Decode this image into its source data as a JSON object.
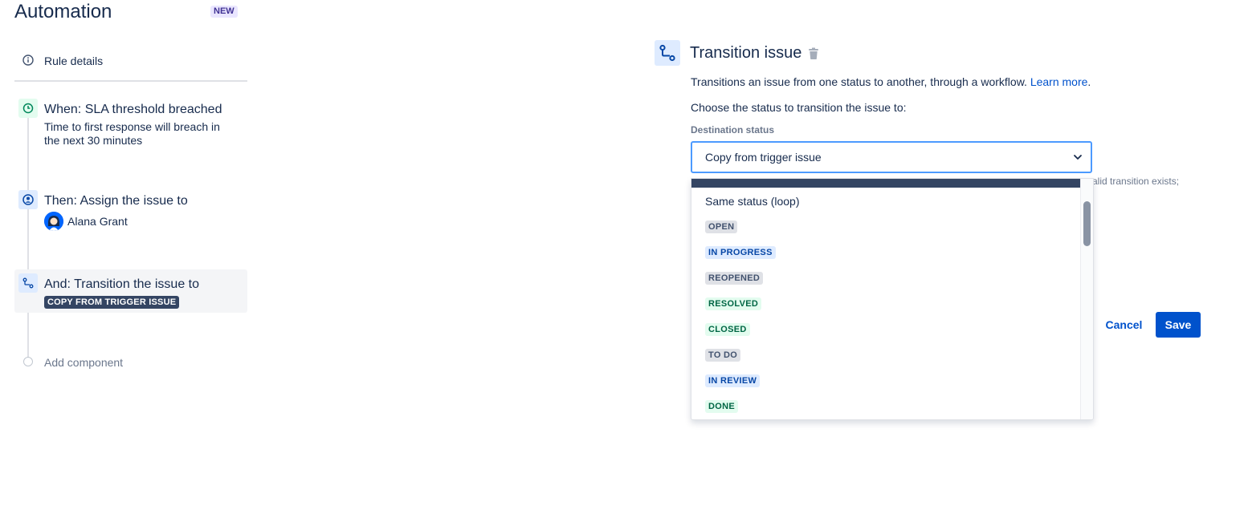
{
  "header": {
    "title": "Automation",
    "badge": "NEW"
  },
  "sidebar": {
    "rule_details": "Rule details",
    "steps": [
      {
        "title": "When: SLA threshold breached",
        "desc_line1": "Time to first response will breach in",
        "desc_line2": "the next 30 minutes",
        "icon": "clock-icon"
      },
      {
        "title": "Then: Assign the issue to",
        "assignee": "Alana Grant",
        "icon": "user-circle-icon"
      },
      {
        "title": "And: Transition the issue to",
        "lozenge": "COPY FROM TRIGGER ISSUE",
        "icon": "transition-icon"
      }
    ],
    "add_component": "Add component"
  },
  "panel": {
    "title": "Transition issue",
    "description": "Transitions an issue from one status to another, through a workflow.",
    "learn_more": "Learn more",
    "period": ".",
    "choose_text": "Choose the status to transition the issue to:",
    "field_label": "Destination status",
    "selected_value": "Copy from trigger issue",
    "helper_tail": "alid transition exists;",
    "menu_options": [
      {
        "label": "Same status (loop)",
        "type": "text"
      },
      {
        "label": "OPEN",
        "type": "lozenge",
        "bg": "#dfe1e6",
        "fg": "#42526e"
      },
      {
        "label": "IN PROGRESS",
        "type": "lozenge",
        "bg": "#deebff",
        "fg": "#0747a6"
      },
      {
        "label": "REOPENED",
        "type": "lozenge",
        "bg": "#dfe1e6",
        "fg": "#42526e"
      },
      {
        "label": "RESOLVED",
        "type": "lozenge",
        "bg": "#e3fcef",
        "fg": "#006644"
      },
      {
        "label": "CLOSED",
        "type": "lozenge",
        "bg": "#e3fcef",
        "fg": "#006644"
      },
      {
        "label": "TO DO",
        "type": "lozenge",
        "bg": "#dfe1e6",
        "fg": "#42526e"
      },
      {
        "label": "IN REVIEW",
        "type": "lozenge",
        "bg": "#deebff",
        "fg": "#0747a6"
      },
      {
        "label": "DONE",
        "type": "lozenge",
        "bg": "#e3fcef",
        "fg": "#006644"
      }
    ],
    "cancel_label": "Cancel",
    "save_label": "Save"
  },
  "colors": {
    "accent": "#0052cc",
    "focus_border": "#4c9aff",
    "text": "#172b4d",
    "subtle": "#6b778c"
  }
}
